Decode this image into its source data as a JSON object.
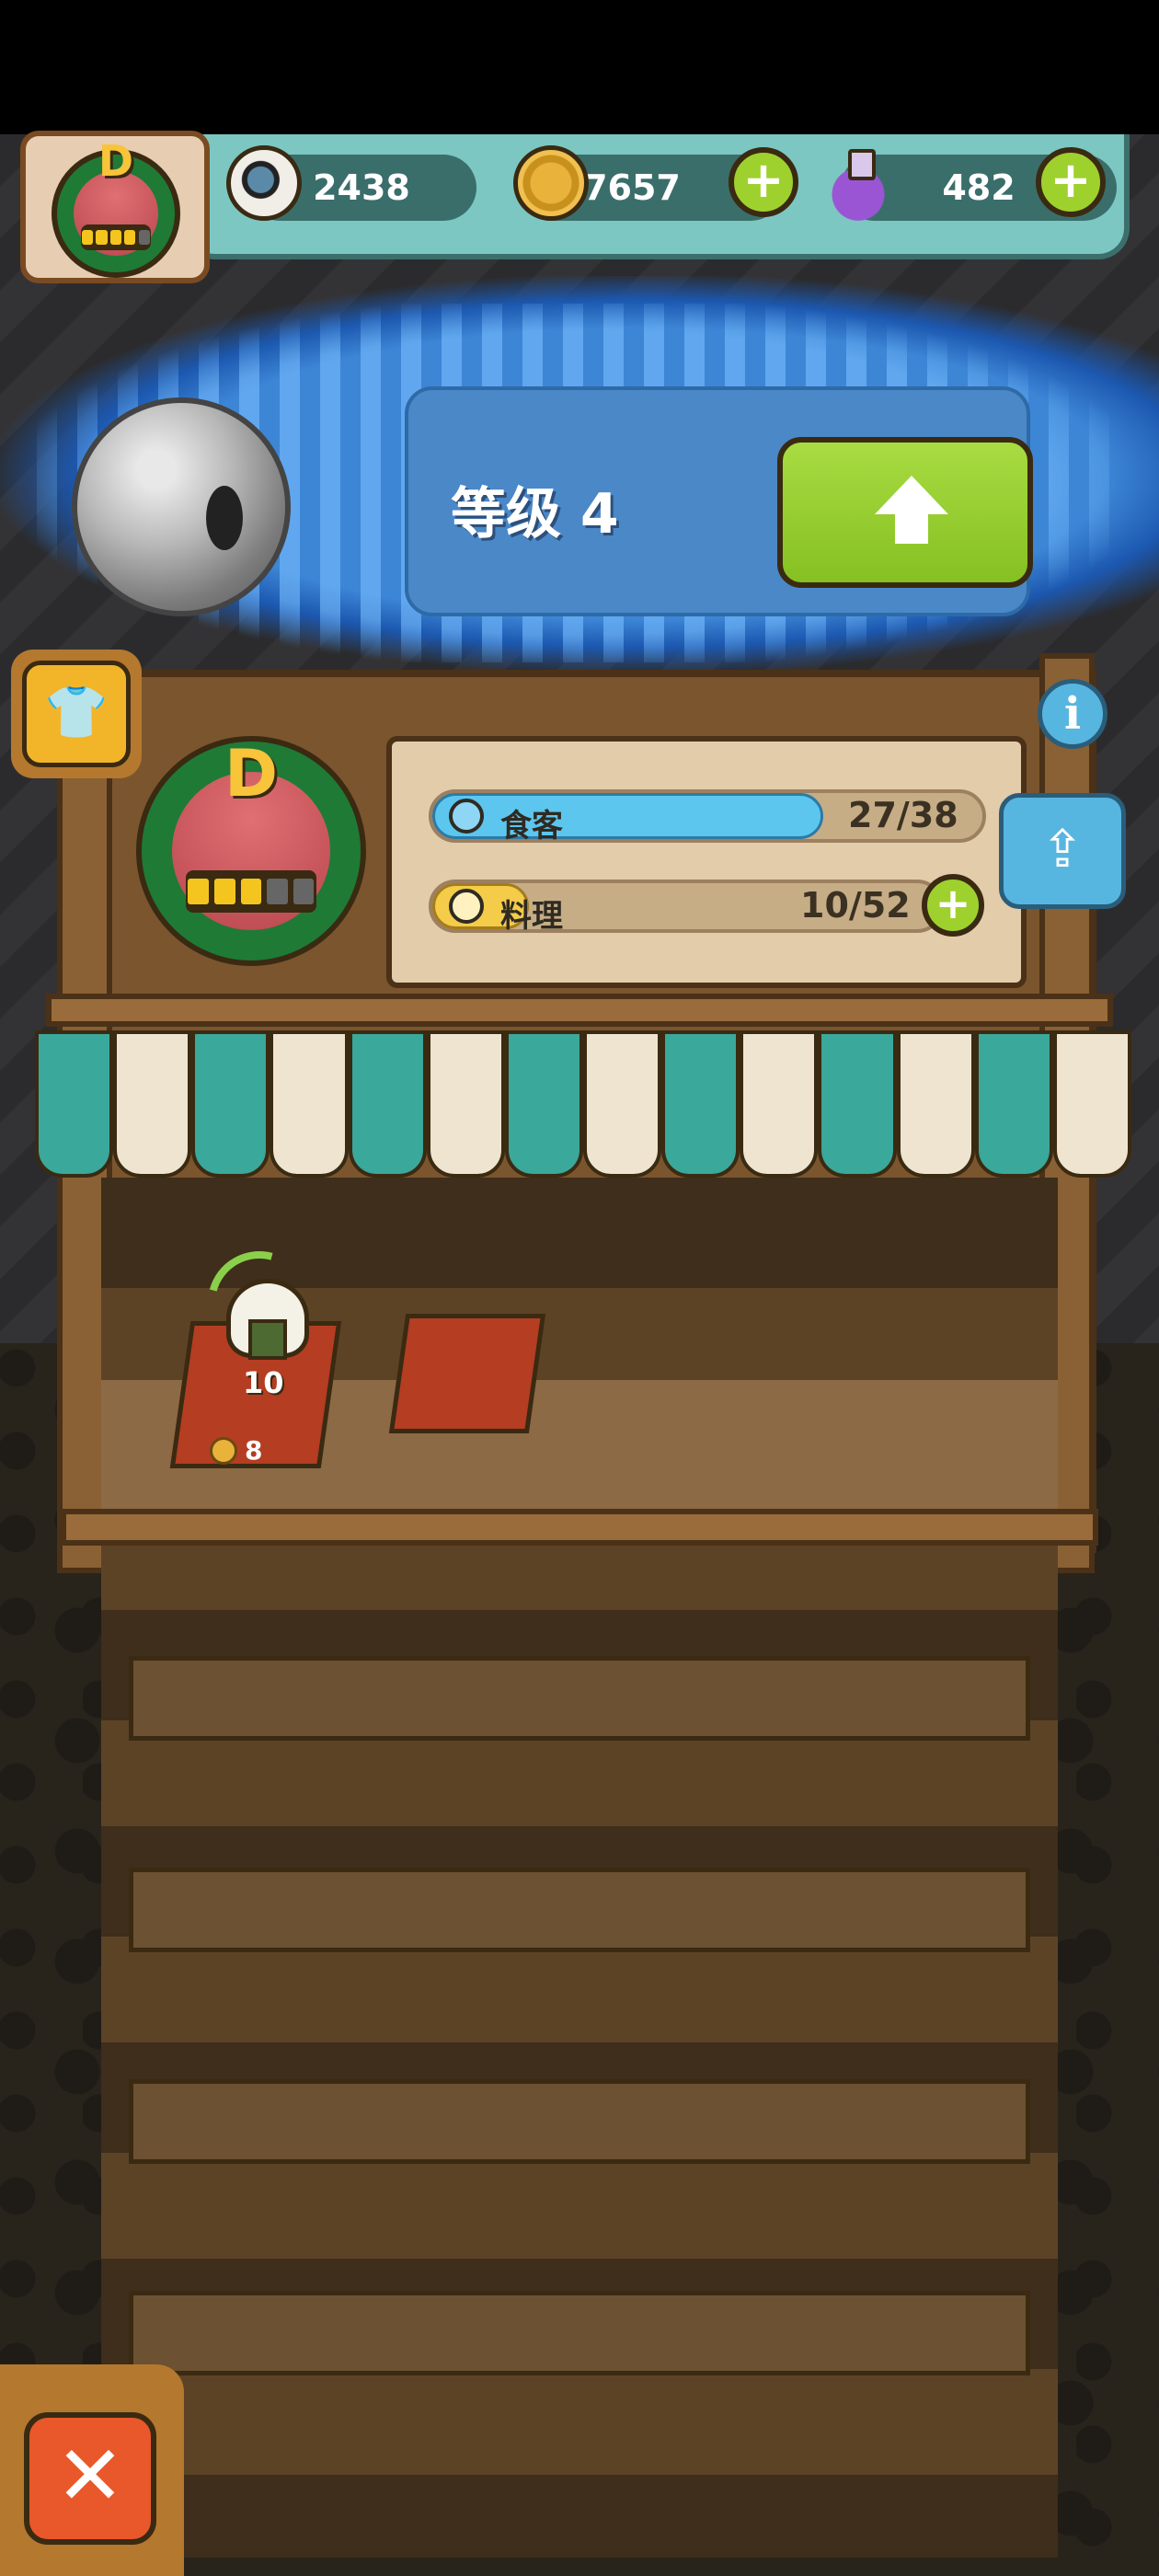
{
  "resources": {
    "eyeballs": "2438",
    "coins": "7657",
    "potions": "482"
  },
  "player": {
    "grade": "D"
  },
  "level": {
    "label": "等级 4"
  },
  "stall": {
    "grade": "D",
    "stats": [
      {
        "label": "食客",
        "count": "27/38",
        "fill": 0.71
      },
      {
        "label": "料理",
        "count": "10/52",
        "fill": 0.19
      }
    ]
  },
  "dish": {
    "quantity": "10",
    "price": "8"
  },
  "icons": {
    "eyeball": "eyeball-icon",
    "coin": "coin-icon",
    "potion": "potion-icon",
    "add": "plus-icon",
    "upgrade": "arrow-up-icon",
    "outfit": "shirt-icon",
    "info": "info-icon",
    "share": "share-icon",
    "close": "close-icon"
  },
  "colors": {
    "accent_green": "#9fd12e",
    "panel_blue": "#4a88c8",
    "teal": "#7cc7c2",
    "close_red": "#e8582a"
  }
}
